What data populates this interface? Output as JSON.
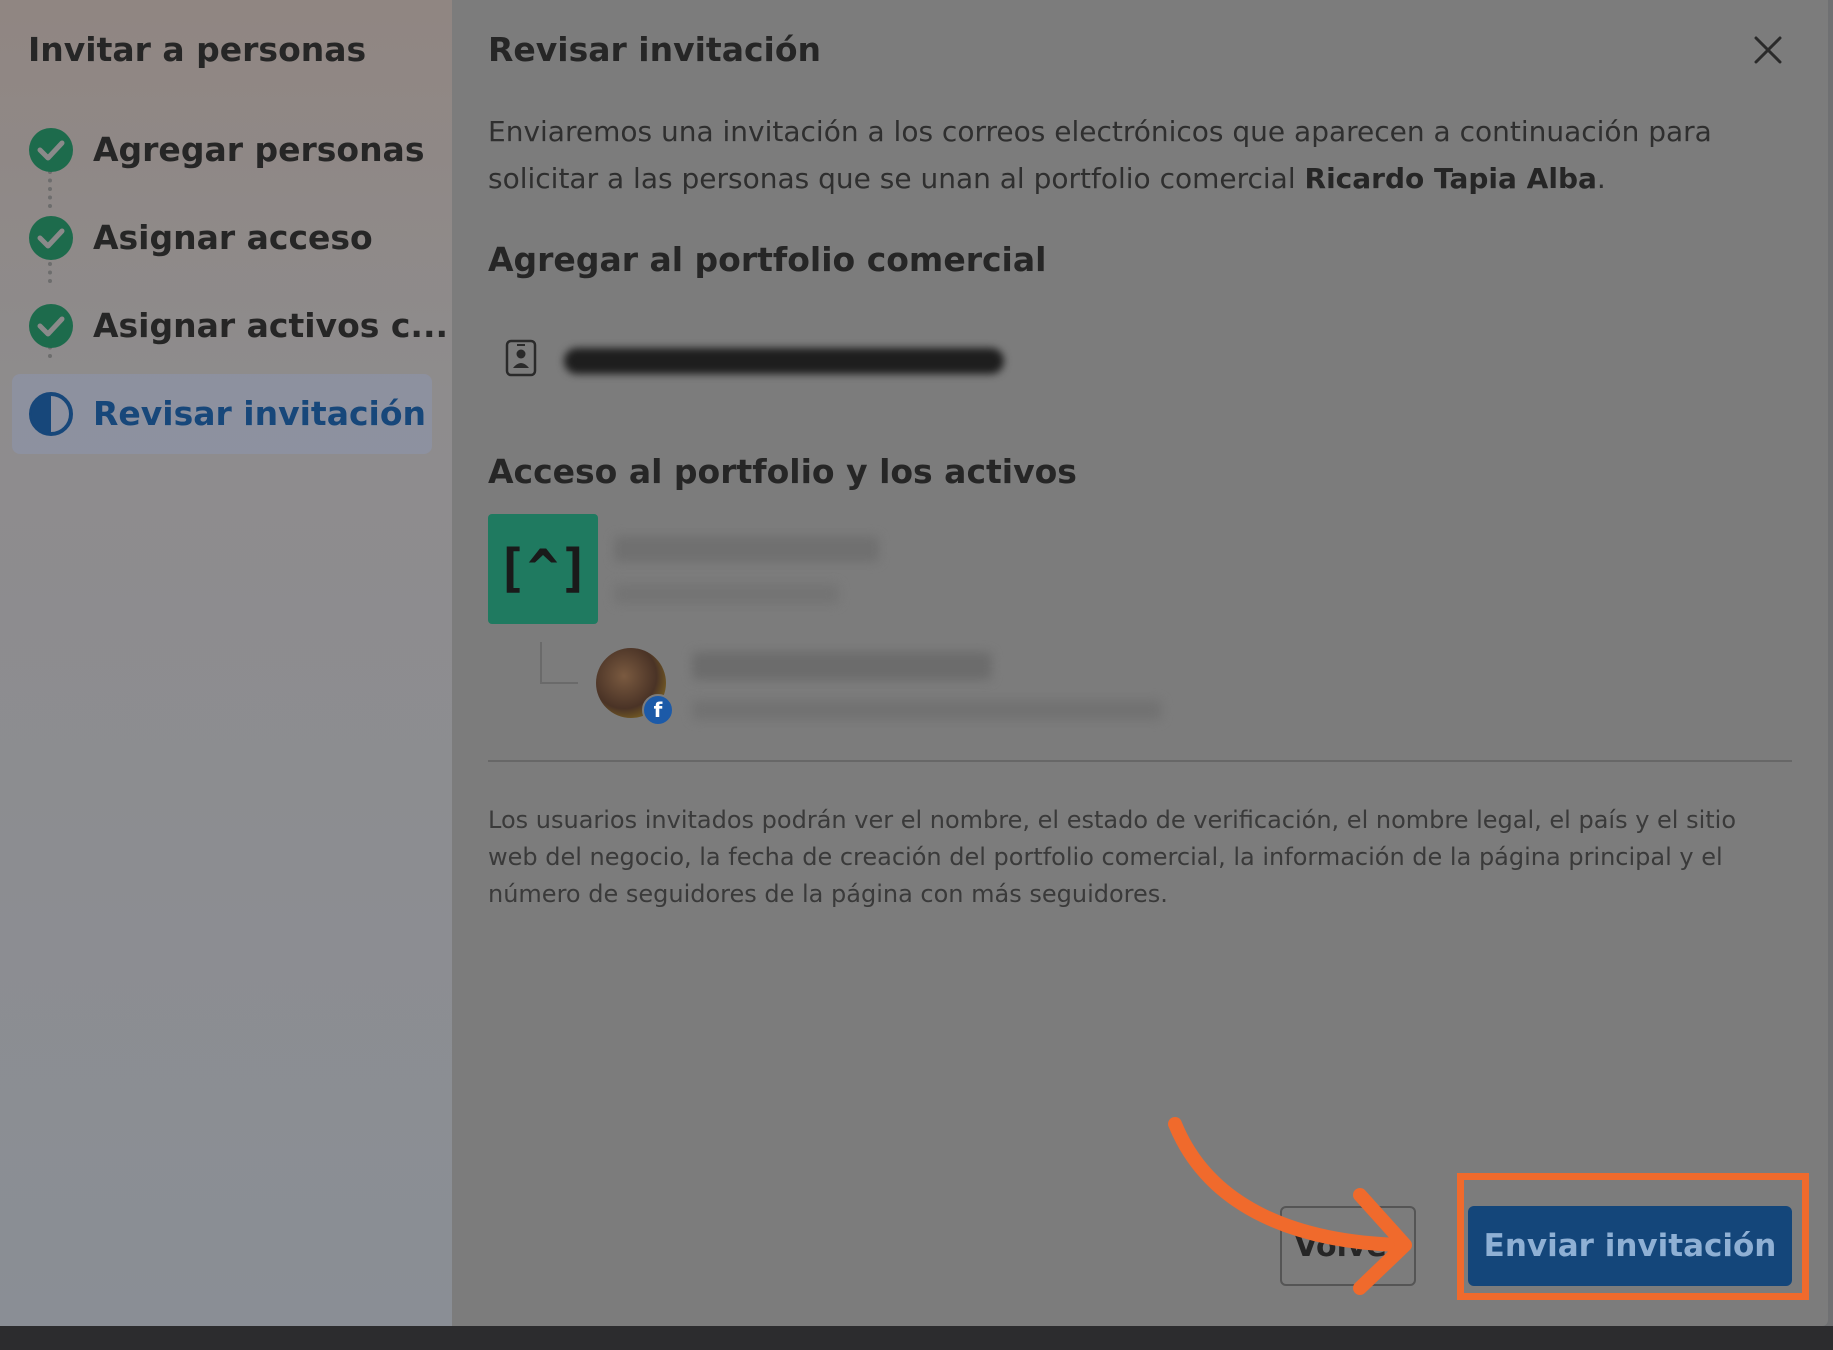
{
  "sidebar": {
    "title": "Invitar a personas",
    "steps": [
      {
        "label": "Agregar personas",
        "status": "complete"
      },
      {
        "label": "Asignar acceso",
        "status": "complete"
      },
      {
        "label": "Asignar activos c...",
        "status": "complete"
      },
      {
        "label": "Revisar invitación",
        "status": "current"
      }
    ]
  },
  "main": {
    "title": "Revisar invitación",
    "intro_text": "Enviaremos una invitación a los correos electrónicos que aparecen a continuación para solicitar a las personas que se unan al portfolio comercial ",
    "portfolio_name": "Ricardo Tapia Alba",
    "intro_suffix": ".",
    "add_section_title": "Agregar al portfolio comercial",
    "access_section_title": "Acceso al portfolio y los activos",
    "portfolio_logo_text": "[^]",
    "disclaimer": "Los usuarios invitados podrán ver el nombre, el estado de verificación, el nombre legal, el país y el sitio web del negocio, la fecha de creación del portfolio comercial, la información de la página principal y el número de seguidores de la página con más seguidores."
  },
  "buttons": {
    "back": "Volver",
    "send": "Enviar invitación"
  },
  "colors": {
    "accent_blue": "#14467a",
    "check_green": "#1d6b4c",
    "annotation_orange": "#f06a2c",
    "portfolio_green": "#1f7a60"
  }
}
